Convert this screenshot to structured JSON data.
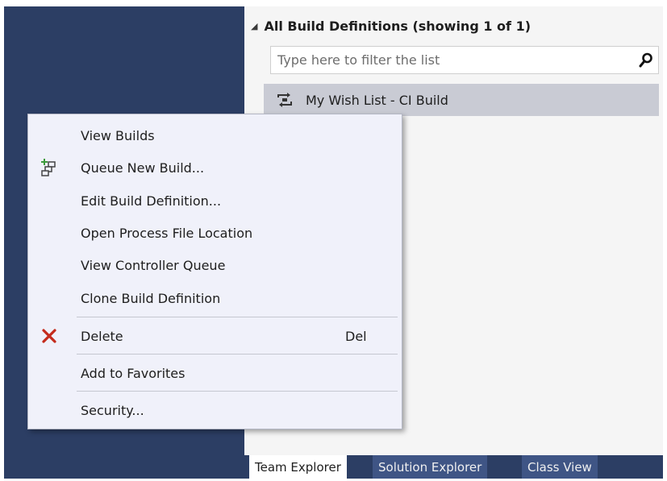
{
  "team_explorer": {
    "section_header": "All Build Definitions (showing 1 of 1)",
    "filter": {
      "placeholder": "Type here to filter the list",
      "value": ""
    },
    "build_definitions": [
      {
        "label": "My Wish List - CI Build",
        "selected": true
      }
    ]
  },
  "context_menu": {
    "items": [
      {
        "label": "View Builds",
        "icon": ""
      },
      {
        "label": "Queue New Build...",
        "icon": "queue-build-icon"
      },
      {
        "label": "Edit Build Definition...",
        "icon": ""
      },
      {
        "label": "Open Process File Location",
        "icon": ""
      },
      {
        "label": "View Controller Queue",
        "icon": ""
      },
      {
        "label": "Clone Build Definition",
        "icon": ""
      },
      {
        "label": "Delete",
        "icon": "delete-x-icon",
        "shortcut": "Del"
      },
      {
        "label": "Add to Favorites",
        "icon": ""
      },
      {
        "label": "Security...",
        "icon": ""
      }
    ]
  },
  "tabs": [
    {
      "label": "Team Explorer",
      "active": true
    },
    {
      "label": "Solution Explorer",
      "active": false
    },
    {
      "label": "Class View",
      "active": false
    }
  ],
  "colors": {
    "dark_panel": "#2c3e64",
    "inactive_tab": "#3f5585",
    "menu_background": "#f0f1fa",
    "selected_item": "#c9cbd4",
    "delete_icon": "#c42b1c",
    "queue_icon_plus": "#3b9a3b"
  }
}
